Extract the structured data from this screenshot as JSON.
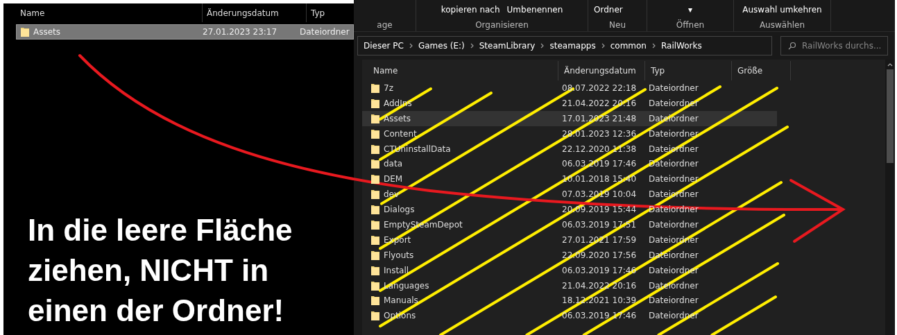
{
  "left_pane": {
    "columns": [
      "Name",
      "Änderungsdatum",
      "Typ"
    ],
    "rows": [
      {
        "name": "Assets",
        "date": "27.01.2023 23:17",
        "type": "Dateiordner",
        "selected": true
      }
    ]
  },
  "caption": "In die leere Fläche ziehen, NICHT in einen der Ordner!",
  "ribbon": {
    "groups": [
      {
        "label": "age"
      },
      {
        "label": "Organisieren",
        "commands": [
          "kopieren nach",
          "Umbenennen"
        ]
      },
      {
        "label": "Neu",
        "commands": [
          "Ordner"
        ]
      },
      {
        "label": "Öffnen",
        "commands": [
          "▾"
        ]
      },
      {
        "label": "Auswählen",
        "commands": [
          "Auswahl umkehren"
        ]
      }
    ]
  },
  "address": {
    "path": [
      "Dieser PC",
      "Games (E:)",
      "SteamLibrary",
      "steamapps",
      "common",
      "RailWorks"
    ],
    "search_placeholder": "RailWorks durchs..."
  },
  "file_list": {
    "columns": [
      "Name",
      "Änderungsdatum",
      "Typ",
      "Größe"
    ],
    "rows": [
      {
        "name": "7z",
        "date": "08.07.2022 22:18",
        "type": "Dateiordner",
        "selected": false
      },
      {
        "name": "AddIns",
        "date": "21.04.2022 20:16",
        "type": "Dateiordner",
        "selected": false
      },
      {
        "name": "Assets",
        "date": "17.01.2023 21:48",
        "type": "Dateiordner",
        "selected": true
      },
      {
        "name": "Content",
        "date": "28.01.2023 12:36",
        "type": "Dateiordner",
        "selected": false
      },
      {
        "name": "CTUninstallData",
        "date": "22.12.2020 11:38",
        "type": "Dateiordner",
        "selected": false
      },
      {
        "name": "data",
        "date": "06.03.2019 17:46",
        "type": "Dateiordner",
        "selected": false
      },
      {
        "name": "DEM",
        "date": "10.01.2018 15:40",
        "type": "Dateiordner",
        "selected": false
      },
      {
        "name": "dev",
        "date": "07.03.2019 10:04",
        "type": "Dateiordner",
        "selected": false
      },
      {
        "name": "Dialogs",
        "date": "20.09.2019 15:44",
        "type": "Dateiordner",
        "selected": false
      },
      {
        "name": "EmptySteamDepot",
        "date": "06.03.2019 17:51",
        "type": "Dateiordner",
        "selected": false
      },
      {
        "name": "Export",
        "date": "27.01.2021 17:59",
        "type": "Dateiordner",
        "selected": false
      },
      {
        "name": "Flyouts",
        "date": "22.09.2020 17:56",
        "type": "Dateiordner",
        "selected": false
      },
      {
        "name": "Install",
        "date": "06.03.2019 17:46",
        "type": "Dateiordner",
        "selected": false
      },
      {
        "name": "Languages",
        "date": "21.04.2022 20:16",
        "type": "Dateiordner",
        "selected": false
      },
      {
        "name": "Manuals",
        "date": "18.12.2021 10:39",
        "type": "Dateiordner",
        "selected": false
      },
      {
        "name": "Options",
        "date": "06.03.2019 17:46",
        "type": "Dateiordner",
        "selected": false
      }
    ]
  }
}
